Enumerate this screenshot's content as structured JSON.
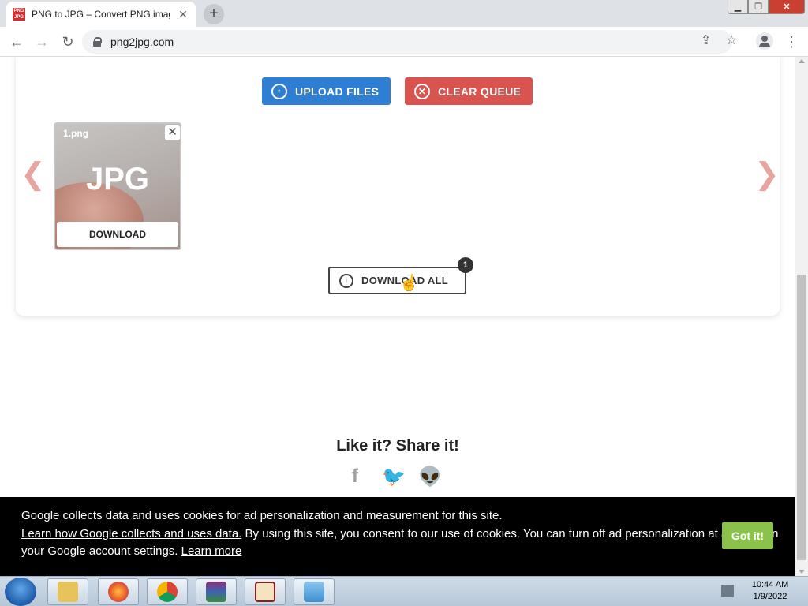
{
  "browser": {
    "tab_title": "PNG to JPG – Convert PNG imag",
    "favicon_text": "PNG JPG",
    "url": "png2jpg.com"
  },
  "page": {
    "upload_label": "UPLOAD FILES",
    "clear_label": "CLEAR QUEUE",
    "file": {
      "name": "1.png",
      "format": "JPG",
      "download_label": "DOWNLOAD"
    },
    "download_all_label": "DOWNLOAD ALL",
    "download_all_count": "1",
    "share_title": "Like it? Share it!"
  },
  "cookie_banner": {
    "text1": "Google collects data and uses cookies for ad personalization and measurement for this site.",
    "link1": "Learn how Google collects and uses data.",
    "text2": " By using this site, you consent to our use of cookies. You can turn off ad personalization at any time in your Google account settings.",
    "link2": "Learn more",
    "button": "Got it!"
  },
  "taskbar": {
    "time": "10:44 AM",
    "date": "1/9/2022",
    "apps": [
      "explorer",
      "firefox",
      "chrome",
      "winrar",
      "vi-app",
      "photo-viewer"
    ]
  },
  "colors": {
    "upload": "#2e7fd3",
    "clear": "#d9534f",
    "got_it": "#8bc34a",
    "arrows": "#e8a49e"
  }
}
